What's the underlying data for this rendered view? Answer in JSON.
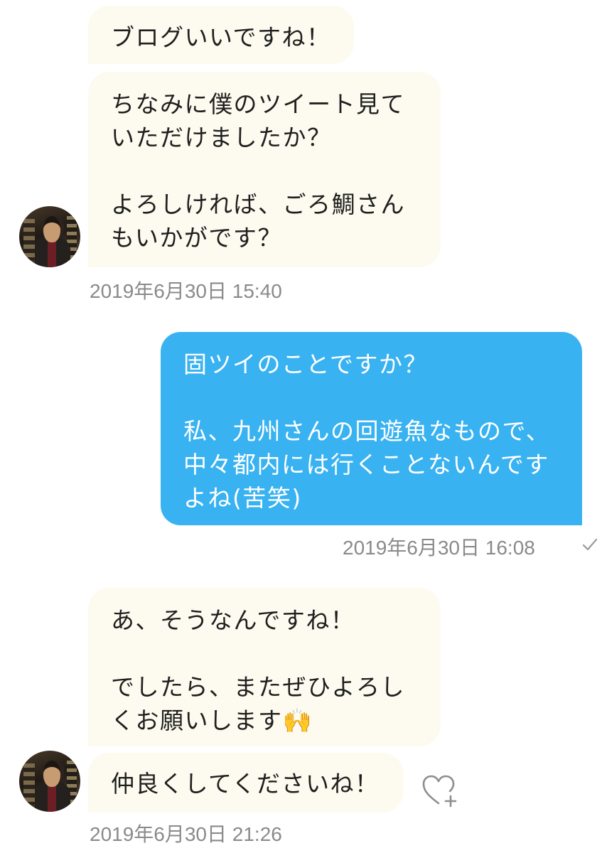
{
  "messages": [
    {
      "dir": "in",
      "text": "ブログいいですね！"
    },
    {
      "dir": "in",
      "text": "ちなみに僕のツイート見て\nいただけましたか？\n\nよろしければ、ごろ鯛さん\nもいかがです？"
    },
    {
      "dir": "out",
      "text": "固ツイのことですか？\n\n私、九州さんの回遊魚なもので、\n中々都内には行くことないんです\nよね(苦笑)"
    },
    {
      "dir": "in",
      "text": "あ、そうなんですね！\n\nでしたら、またぜひよろし\nくお願いします🙌"
    },
    {
      "dir": "in",
      "text": "仲良くしてくださいね！"
    }
  ],
  "timestamps": {
    "t1": "2019年6月30日 15:40",
    "t2": "2019年6月30日 16:08",
    "t3": "2019年6月30日 21:26"
  },
  "icons": {
    "avatar": "user-avatar",
    "read": "checkmark-icon",
    "like": "heart-add-icon"
  },
  "colors": {
    "incoming_bubble": "#fdfbef",
    "outgoing_bubble": "#39b2f1",
    "timestamp": "#8a8a8a"
  }
}
